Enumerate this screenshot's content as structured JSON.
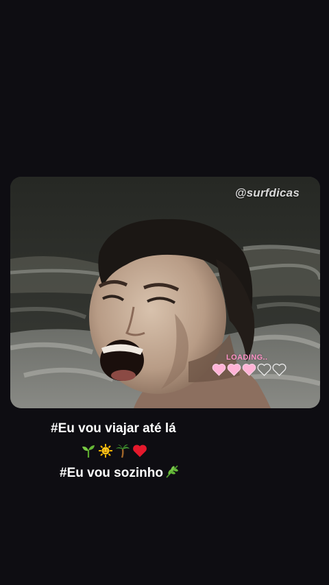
{
  "watermark": "@surfdicas",
  "loading": {
    "label": "LOADING..",
    "hearts_filled": 3,
    "hearts_total": 5,
    "heart_color": "#ffb3d6"
  },
  "caption": {
    "line1": "#Eu vou viajar até lá",
    "emojis": [
      "seedling-icon",
      "sun-icon",
      "palm-tree-icon",
      "red-heart-icon"
    ],
    "line2": "#Eu vou sozinho",
    "line2_emoji": "herb-icon"
  },
  "colors": {
    "background": "#0e0d12",
    "caption_text": "#ffffff",
    "loading_text": "#ff93c7"
  }
}
